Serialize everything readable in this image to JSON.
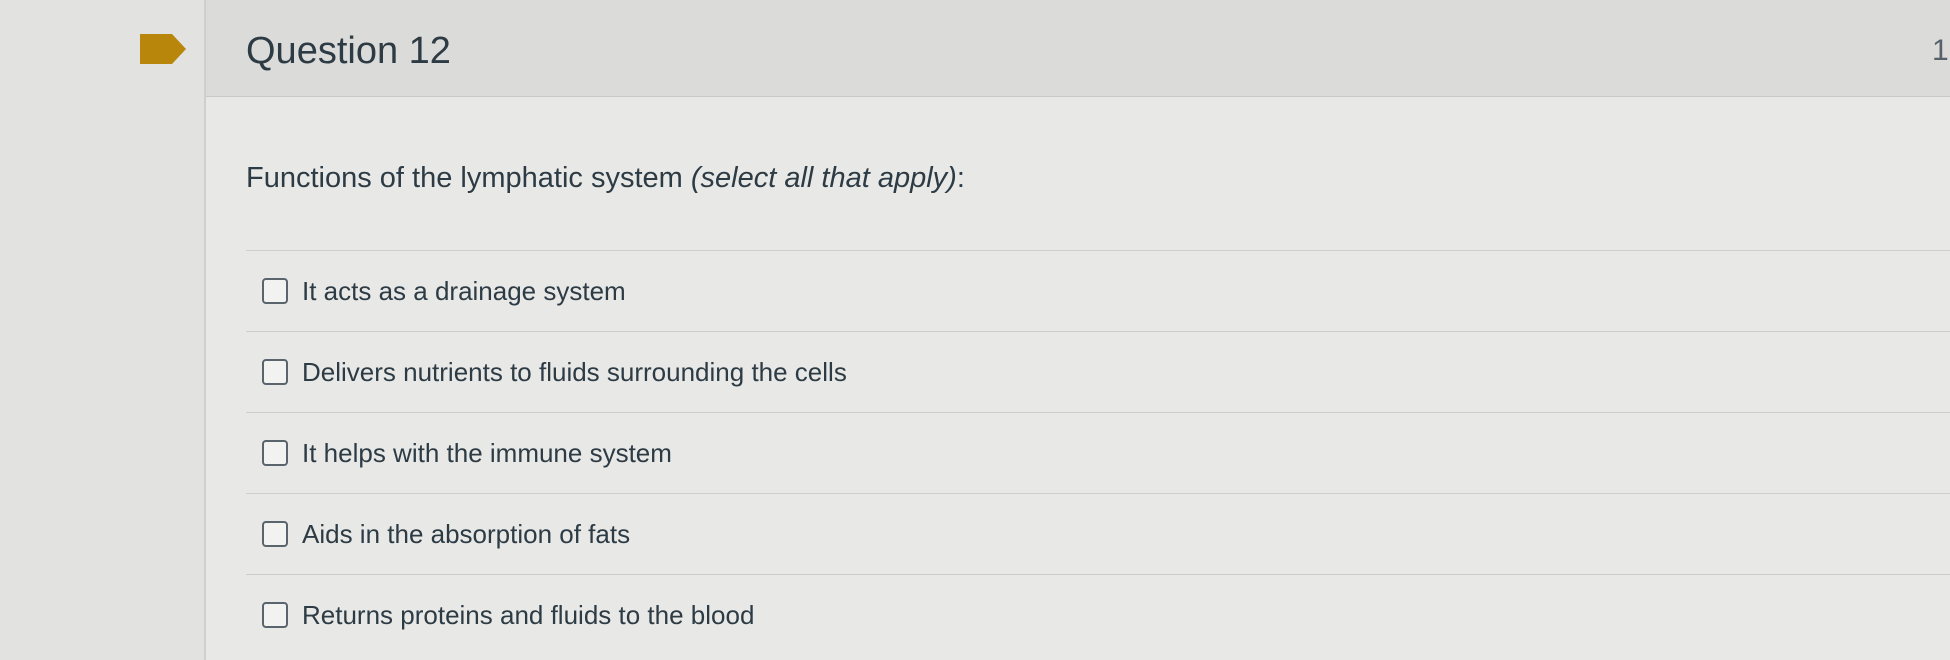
{
  "question": {
    "title": "Question 12",
    "points": "1",
    "prompt": "Functions of the lymphatic system ",
    "prompt_emphasis": "(select all that apply)",
    "prompt_suffix": ":",
    "flag_color": "#b8860b",
    "answers": [
      {
        "label": "It acts as a drainage system",
        "checked": false
      },
      {
        "label": "Delivers nutrients to fluids surrounding the cells",
        "checked": false
      },
      {
        "label": "It helps with the immune system",
        "checked": false
      },
      {
        "label": "Aids in the absorption of fats",
        "checked": false
      },
      {
        "label": "Returns proteins and fluids to the blood",
        "checked": false
      }
    ]
  }
}
